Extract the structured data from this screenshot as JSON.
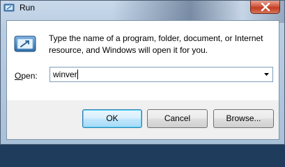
{
  "window": {
    "title": "Run",
    "close_symbol": "✕"
  },
  "content": {
    "description": "Type the name of a program, folder, document, or Internet resource, and Windows will open it for you.",
    "open_label_accel": "O",
    "open_label_rest": "pen:",
    "input_value": "winver"
  },
  "buttons": {
    "ok": "OK",
    "cancel": "Cancel",
    "browse": "Browse..."
  },
  "icons": {
    "title": "run-icon",
    "dialog": "run-icon",
    "close": "close-icon",
    "dropdown": "chevron-down-icon"
  },
  "colors": {
    "accent": "#3c7fb1",
    "close_red": "#c23c22"
  }
}
